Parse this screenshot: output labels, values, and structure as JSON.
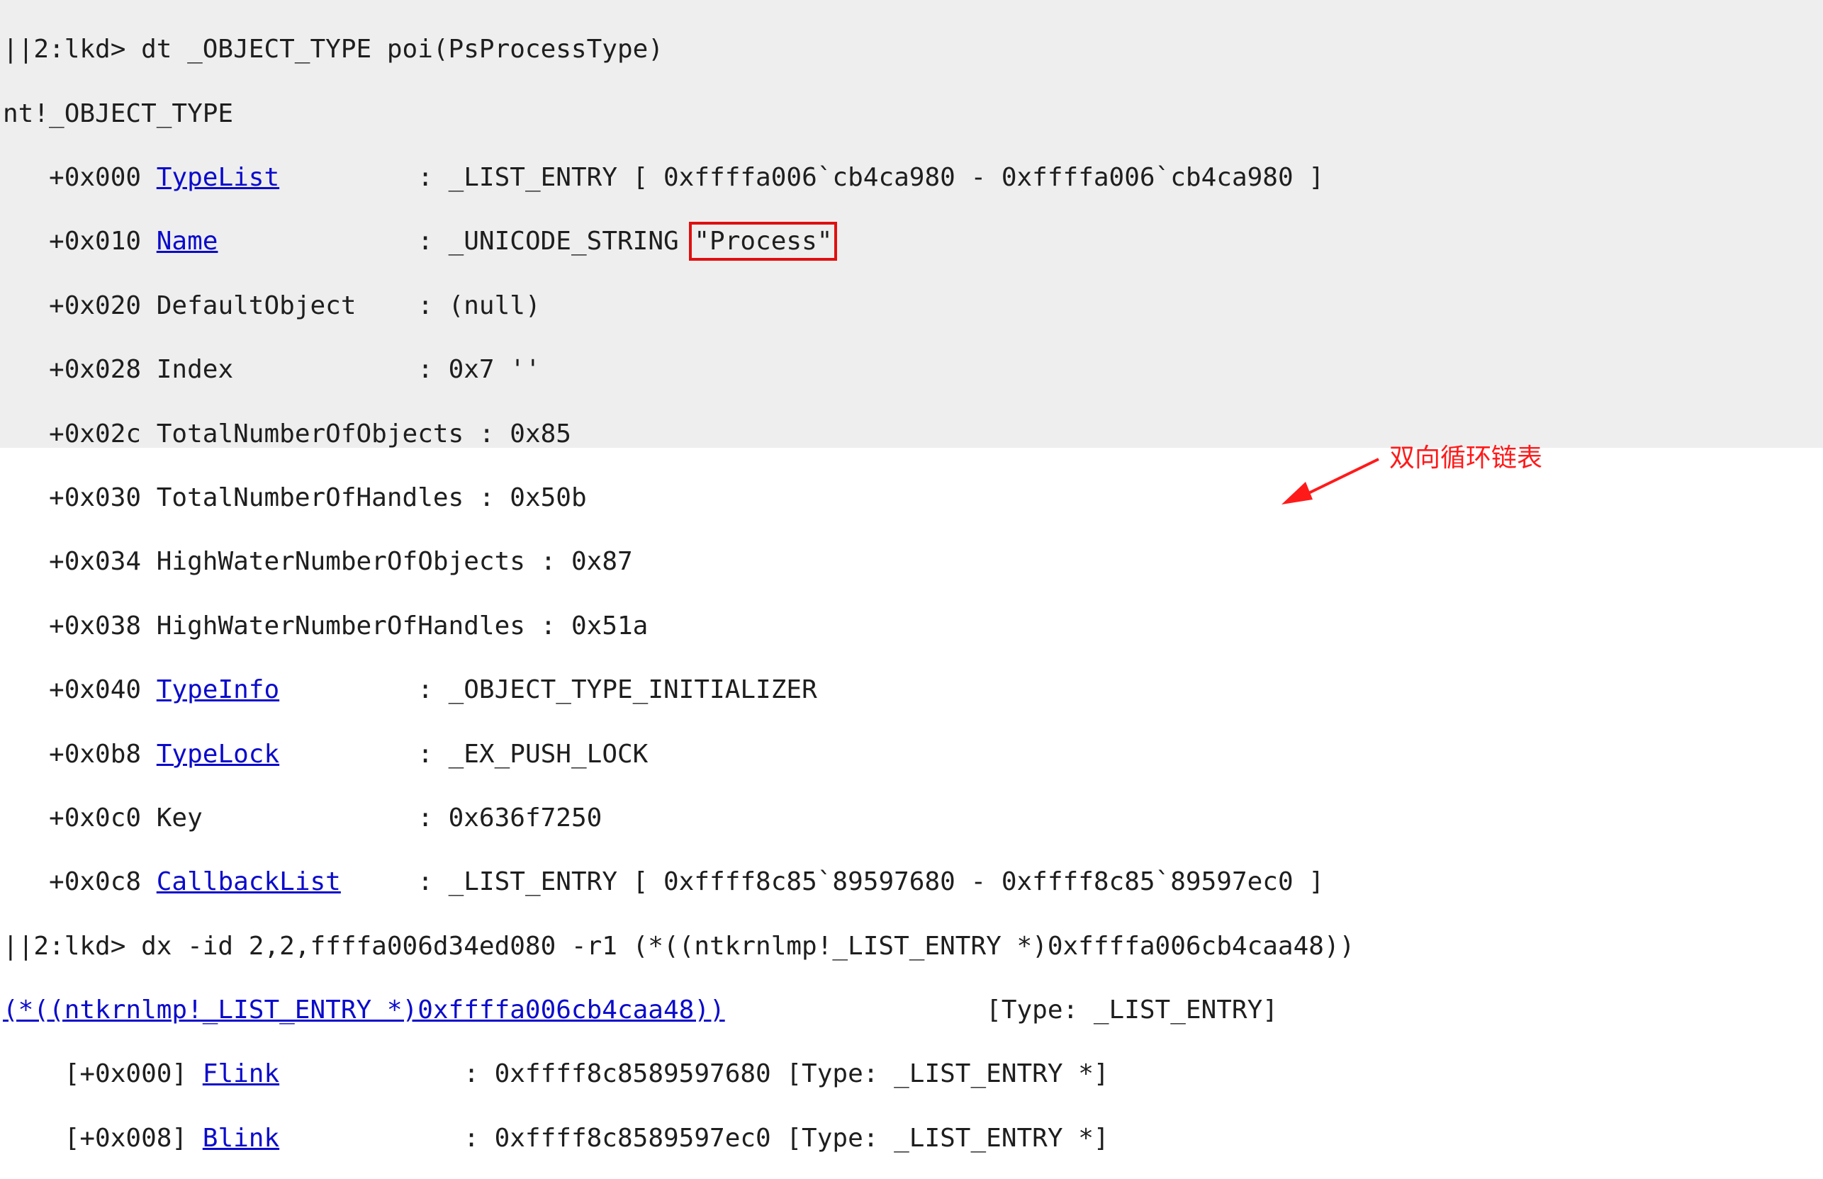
{
  "output": {
    "cmd1": "||2:lkd> dt _OBJECT_TYPE poi(PsProcessType)",
    "type_header": "nt!_OBJECT_TYPE",
    "fields": [
      {
        "off": "   +0x000 ",
        "name": "TypeList",
        "link": true,
        "pad": "         ",
        "sep": ": ",
        "val": "_LIST_ENTRY [ 0xffffa006`cb4ca980 - 0xffffa006`cb4ca980 ]",
        "val_prefix": "",
        "boxed_val": ""
      },
      {
        "off": "   +0x010 ",
        "name": "Name",
        "link": true,
        "pad": "             ",
        "sep": ": ",
        "val": "",
        "val_prefix": "_UNICODE_STRING ",
        "boxed_val": "\"Process\""
      },
      {
        "off": "   +0x020 ",
        "name": "DefaultObject",
        "link": false,
        "pad": "    ",
        "sep": ": ",
        "val": "(null)",
        "val_prefix": "",
        "boxed_val": ""
      },
      {
        "off": "   +0x028 ",
        "name": "Index",
        "link": false,
        "pad": "            ",
        "sep": ": ",
        "val": "0x7 ''",
        "val_prefix": "",
        "boxed_val": ""
      },
      {
        "off": "   +0x02c ",
        "name": "TotalNumberOfObjects",
        "link": false,
        "pad": " ",
        "sep": ": ",
        "val": "0x85",
        "val_prefix": "",
        "boxed_val": ""
      },
      {
        "off": "   +0x030 ",
        "name": "TotalNumberOfHandles",
        "link": false,
        "pad": " ",
        "sep": ": ",
        "val": "0x50b",
        "val_prefix": "",
        "boxed_val": ""
      },
      {
        "off": "   +0x034 ",
        "name": "HighWaterNumberOfObjects",
        "link": false,
        "pad": " ",
        "sep": ": ",
        "val": "0x87",
        "val_prefix": "",
        "boxed_val": ""
      },
      {
        "off": "   +0x038 ",
        "name": "HighWaterNumberOfHandles",
        "link": false,
        "pad": " ",
        "sep": ": ",
        "val": "0x51a",
        "val_prefix": "",
        "boxed_val": ""
      },
      {
        "off": "   +0x040 ",
        "name": "TypeInfo",
        "link": true,
        "pad": "         ",
        "sep": ": ",
        "val": "_OBJECT_TYPE_INITIALIZER",
        "val_prefix": "",
        "boxed_val": ""
      },
      {
        "off": "   +0x0b8 ",
        "name": "TypeLock",
        "link": true,
        "pad": "         ",
        "sep": ": ",
        "val": "_EX_PUSH_LOCK",
        "val_prefix": "",
        "boxed_val": ""
      },
      {
        "off": "   +0x0c0 ",
        "name": "Key",
        "link": false,
        "pad": "              ",
        "sep": ": ",
        "val": "0x636f7250",
        "val_prefix": "",
        "boxed_val": ""
      },
      {
        "off": "   +0x0c8 ",
        "name": "CallbackList",
        "link": true,
        "pad": "     ",
        "sep": ": ",
        "val": "_LIST_ENTRY [ 0xffff8c85`89597680 - 0xffff8c85`89597ec0 ]",
        "val_prefix": "",
        "boxed_val": ""
      }
    ],
    "cmd2": "||2:lkd> dx -id 2,2,ffffa006d34ed080 -r1 (*((ntkrnlmp!_LIST_ENTRY *)0xffffa006cb4caa48))",
    "dx_link": "(*((ntkrnlmp!_LIST_ENTRY *)0xffffa006cb4caa48))",
    "dx_pad": "                 ",
    "dx_type": "[Type: _LIST_ENTRY]",
    "entries": [
      {
        "off": "    [+0x000] ",
        "name": "Flink",
        "pad": "            ",
        "val": ": 0xffff8c8589597680 [Type: _LIST_ENTRY *]"
      },
      {
        "off": "    [+0x008] ",
        "name": "Blink",
        "pad": "            ",
        "val": ": 0xffff8c8589597ec0 [Type: _LIST_ENTRY *]"
      }
    ]
  },
  "annotation": {
    "label": "双向循环链表",
    "color": "#ff1a1a"
  },
  "colors": {
    "link": "#0b0bcc",
    "highlight_box": "#e01010",
    "shaded_bg": "#eeeeee"
  }
}
